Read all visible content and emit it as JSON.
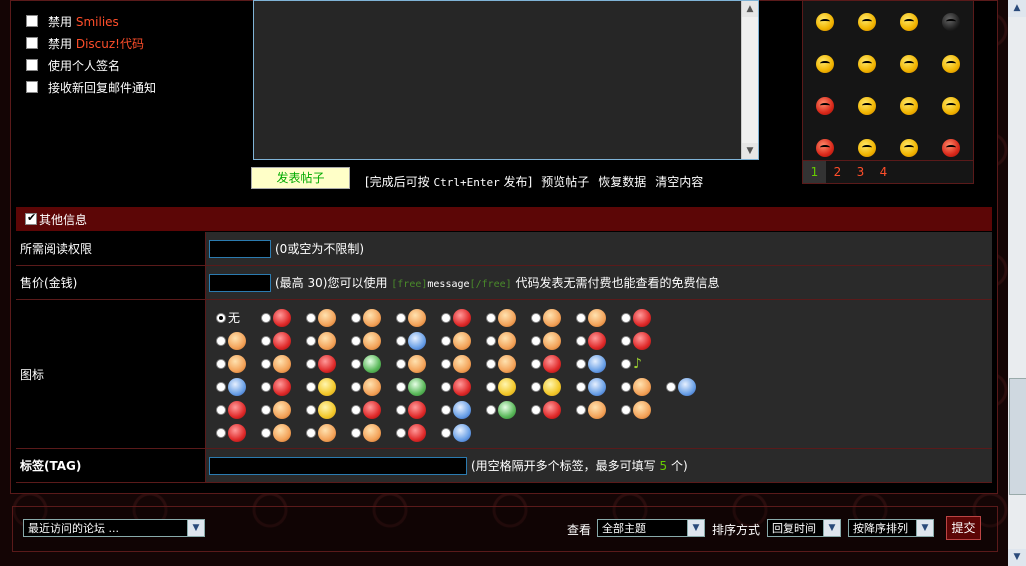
{
  "options": [
    {
      "prefix": "禁用",
      "highlight": "Smilies"
    },
    {
      "prefix": "禁用",
      "highlight": "Discuz!代码"
    },
    {
      "prefix": "使用个人签名",
      "highlight": ""
    },
    {
      "prefix": "接收新回复邮件通知",
      "highlight": ""
    }
  ],
  "smilies_pager": [
    "1",
    "2",
    "3",
    "4"
  ],
  "post": {
    "submit_label": "发表帖子",
    "hint_prefix": "[完成后可按 ",
    "hint_keys": "Ctrl+Enter",
    "hint_suffix": " 发布]",
    "preview": "预览帖子",
    "restore": "恢复数据",
    "clear": "清空内容"
  },
  "other_info": {
    "title": "其他信息",
    "read_perm": {
      "label": "所需阅读权限",
      "hint": "(0或空为不限制)"
    },
    "price": {
      "label": "售价(金钱)",
      "hint_a": "(最高 30)您可以使用 ",
      "code_open": "[free]",
      "code_mid": "message",
      "code_close": "[/free]",
      "hint_b": " 代码发表无需付费也能查看的免费信息"
    },
    "icon": {
      "label": "图标",
      "none": "无"
    },
    "tag": {
      "label": "标签(TAG)",
      "hint_a": "(用空格隔开多个标签，最多可填写 ",
      "count": "5",
      "hint_b": " 个)"
    }
  },
  "footer": {
    "forum_jump": "最近访问的论坛 ...",
    "view_label": "查看",
    "view_value": "全部主题",
    "sort_label": "排序方式",
    "sort_value": "回复时间",
    "order_value": "按降序排列",
    "submit": "提交"
  }
}
